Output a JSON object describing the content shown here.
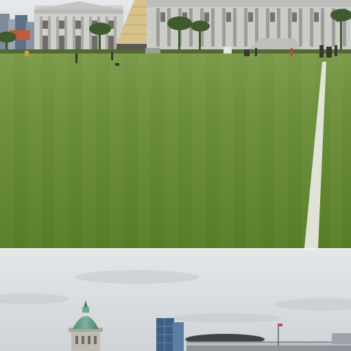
{
  "image": {
    "kind": "photo-collage",
    "panels": [
      {
        "name": "field-with-national-gallery"
      },
      {
        "name": "skyline-with-dome"
      }
    ],
    "palette": {
      "sky_top": "#d9dde1",
      "grass_far": "#6f8f3f",
      "grass_near": "#5c7f2b",
      "stone": "#cfd0cd",
      "dome_green": "#5f9e86",
      "tower_blue": "#3e5f86"
    }
  }
}
